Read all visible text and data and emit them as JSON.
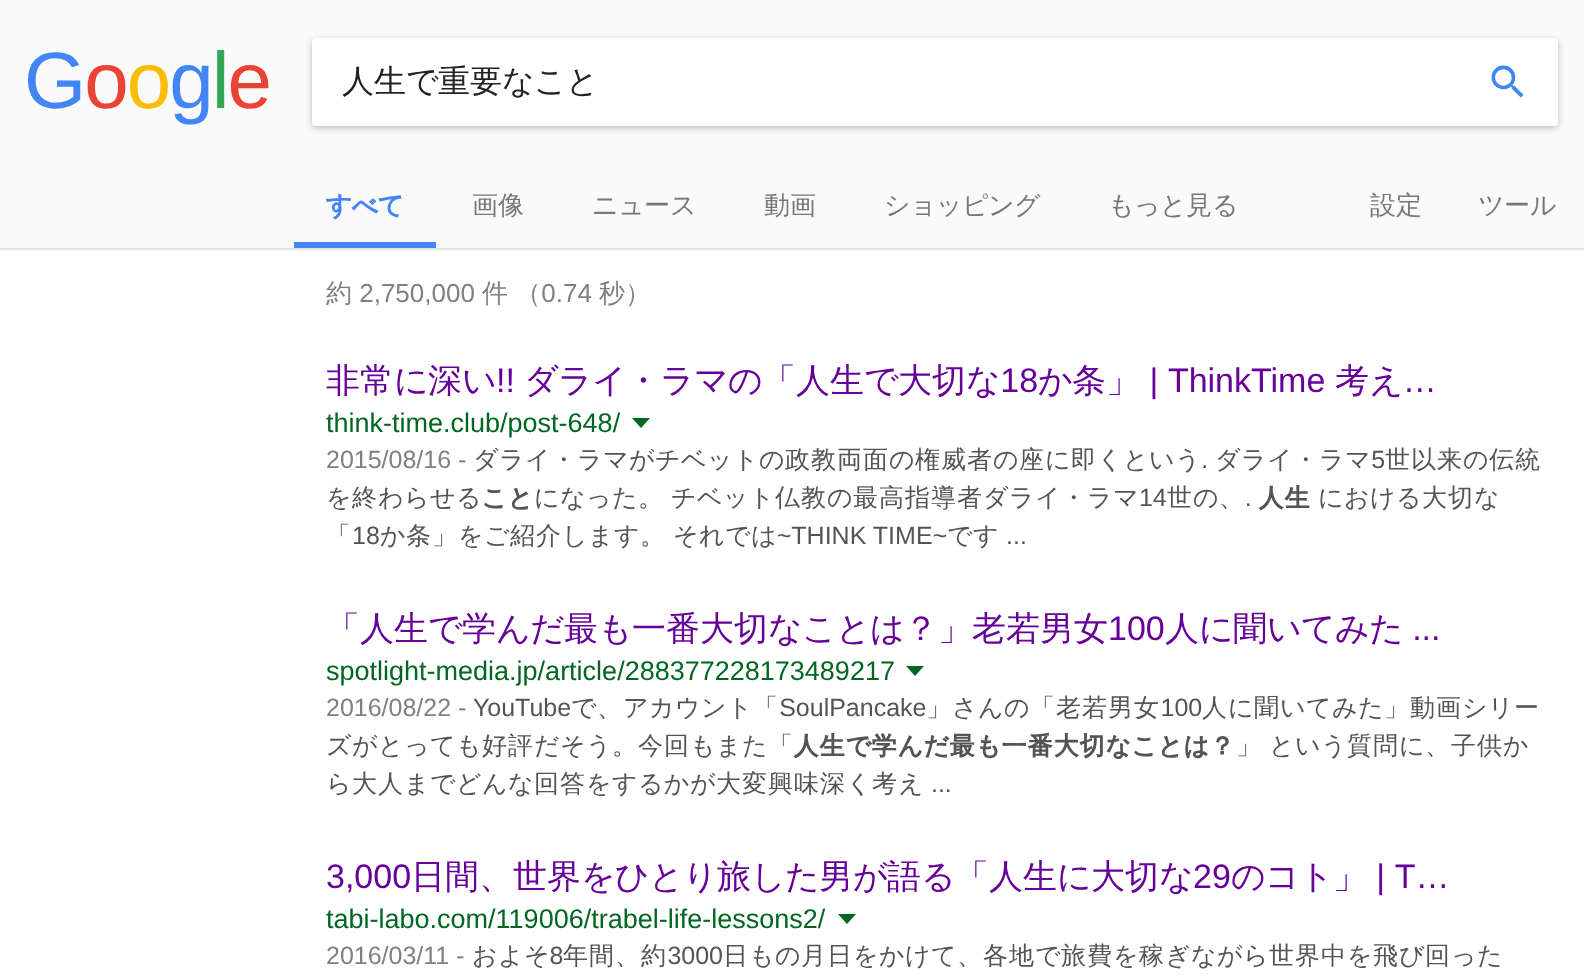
{
  "logo": {
    "letters": [
      {
        "char": "G",
        "color": "#4285f4"
      },
      {
        "char": "o",
        "color": "#ea4335"
      },
      {
        "char": "o",
        "color": "#fbbc05"
      },
      {
        "char": "g",
        "color": "#4285f4"
      },
      {
        "char": "l",
        "color": "#34a853"
      },
      {
        "char": "e",
        "color": "#ea4335"
      }
    ]
  },
  "search": {
    "value": "人生で重要なこと"
  },
  "tabs": [
    {
      "label": "すべて",
      "selected": true
    },
    {
      "label": "画像",
      "selected": false
    },
    {
      "label": "ニュース",
      "selected": false
    },
    {
      "label": "動画",
      "selected": false
    },
    {
      "label": "ショッピング",
      "selected": false
    },
    {
      "label": "もっと見る",
      "selected": false
    }
  ],
  "tools": [
    "設定",
    "ツール"
  ],
  "result_stats": "約 2,750,000 件 （0.74 秒）",
  "results": [
    {
      "title": "非常に深い!! ダライ・ラマの「人生で大切な18か条」 | ThinkTime 考え…",
      "url": "think-time.club/post-648/",
      "date": "2015/08/16 - ",
      "snippet": "ダライ・ラマがチベットの政教両面の権威者の座に即くという. ダライ・ラマ5世以来の伝統を終わらせる**こと**になった。 チベット仏教の最高指導者ダライ・ラマ14世の、. **人生** における大切な「18か条」をご紹介します。 それでは~THINK TIME~です ..."
    },
    {
      "title": "「人生で学んだ最も一番大切なことは？」老若男女100人に聞いてみた ...",
      "url": "spotlight-media.jp/article/288377228173489217",
      "date": "2016/08/22 - ",
      "snippet": "YouTubeで、アカウント「SoulPancake」さんの「老若男女100人に聞いてみた」動画シリーズがとっても好評だそう。今回もまた「**人生で学んだ最も一番大切なことは？**」 という質問に、子供から大人までどんな回答をするかが大変興味深く考え ..."
    },
    {
      "title": "3,000日間、世界をひとり旅した男が語る「人生に大切な29のコト」 | T…",
      "url": "tabi-labo.com/119006/trabel-life-lessons2/",
      "date": "2016/03/11 - ",
      "snippet": "およそ8年間、約3000日もの月日をかけて、各地で旅費を稼ぎながら世界中を飛び回った"
    }
  ]
}
